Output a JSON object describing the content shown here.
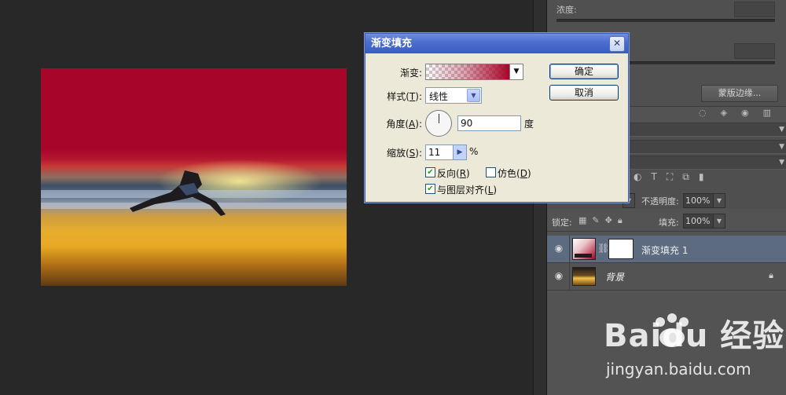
{
  "canvas": {
    "alt": "beach runner photo with red gradient fill overlay"
  },
  "dialog": {
    "title": "渐变填充",
    "gradient_label": "渐变:",
    "style_label": "样式(",
    "style_key": "T",
    "style_tail": "):",
    "style_value": "线性",
    "angle_label": "角度(",
    "angle_key": "A",
    "angle_tail": "):",
    "angle_value": "90",
    "angle_unit": "度",
    "scale_label": "缩放(",
    "scale_key": "S",
    "scale_tail": "):",
    "scale_value": "11",
    "scale_unit": "%",
    "reverse_label": "反向(",
    "reverse_key": "R",
    "reverse_tail": ")",
    "reverse_checked": true,
    "dither_label": "仿色(",
    "dither_key": "D",
    "dither_tail": ")",
    "dither_checked": false,
    "align_label": "与图层对齐(",
    "align_key": "L",
    "align_tail": ")",
    "align_checked": true,
    "ok_label": "确定",
    "cancel_label": "取消",
    "close_glyph": "✕"
  },
  "properties": {
    "density_label": "浓度:",
    "mask_edge_label": "蒙版边缘..."
  },
  "layers": {
    "opacity_label": "不透明度:",
    "opacity_value": "100%",
    "lock_label": "锁定:",
    "fill_label": "填充:",
    "fill_value": "100%",
    "items": [
      {
        "name": "渐变填充 1"
      },
      {
        "name": "背景"
      }
    ]
  },
  "watermark": {
    "logo": "Baidu 经验",
    "url": "jingyan.baidu.com"
  },
  "colors": {
    "gradient_red": "#a70529",
    "panel_bg": "#535353",
    "selected_layer": "#5d6b80",
    "dialog_title": "#4d6fd0"
  }
}
